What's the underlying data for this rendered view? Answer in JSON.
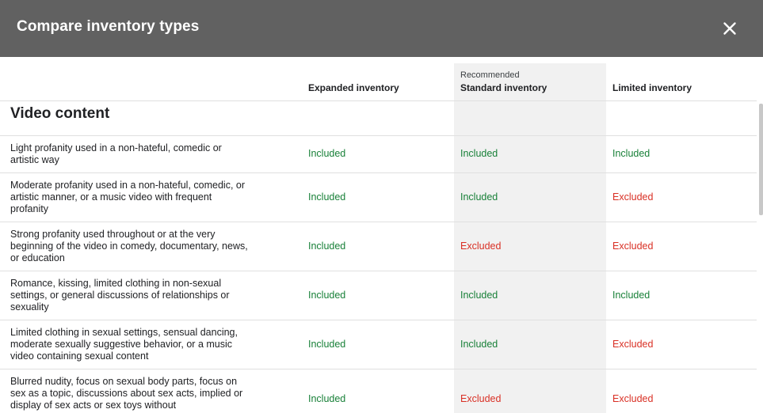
{
  "dialog": {
    "title": "Compare inventory types",
    "close_icon": "close-icon"
  },
  "columns": {
    "expanded": "Expanded inventory",
    "standard_tag": "Recommended",
    "standard": "Standard inventory",
    "limited": "Limited inventory"
  },
  "section": {
    "title": "Video content"
  },
  "rows": [
    {
      "desc": "Light profanity used in a non-hateful, comedic or artistic way",
      "expanded": "Included",
      "standard": "Included",
      "limited": "Included"
    },
    {
      "desc": "Moderate profanity used in a non-hateful, comedic, or artistic manner, or a music video with frequent profanity",
      "expanded": "Included",
      "standard": "Included",
      "limited": "Excluded"
    },
    {
      "desc": "Strong profanity used throughout or at the very beginning of the video in comedy, documentary, news, or education",
      "expanded": "Included",
      "standard": "Excluded",
      "limited": "Excluded"
    },
    {
      "desc": "Romance, kissing, limited clothing in non-sexual settings, or general discussions of relationships or sexuality",
      "expanded": "Included",
      "standard": "Included",
      "limited": "Included"
    },
    {
      "desc": "Limited clothing in sexual settings, sensual dancing, moderate sexually suggestive behavior, or a music video containing sexual content",
      "expanded": "Included",
      "standard": "Included",
      "limited": "Excluded"
    },
    {
      "desc": "Blurred nudity, focus on sexual body parts, focus on sex as a topic, discussions about sex acts, implied or display of sex acts or sex toys without",
      "expanded": "Included",
      "standard": "Excluded",
      "limited": "Excluded"
    }
  ],
  "colors": {
    "titlebar": "#616161",
    "included": "#188038",
    "excluded": "#d93025",
    "recommended_bg": "#f1f1f1"
  }
}
